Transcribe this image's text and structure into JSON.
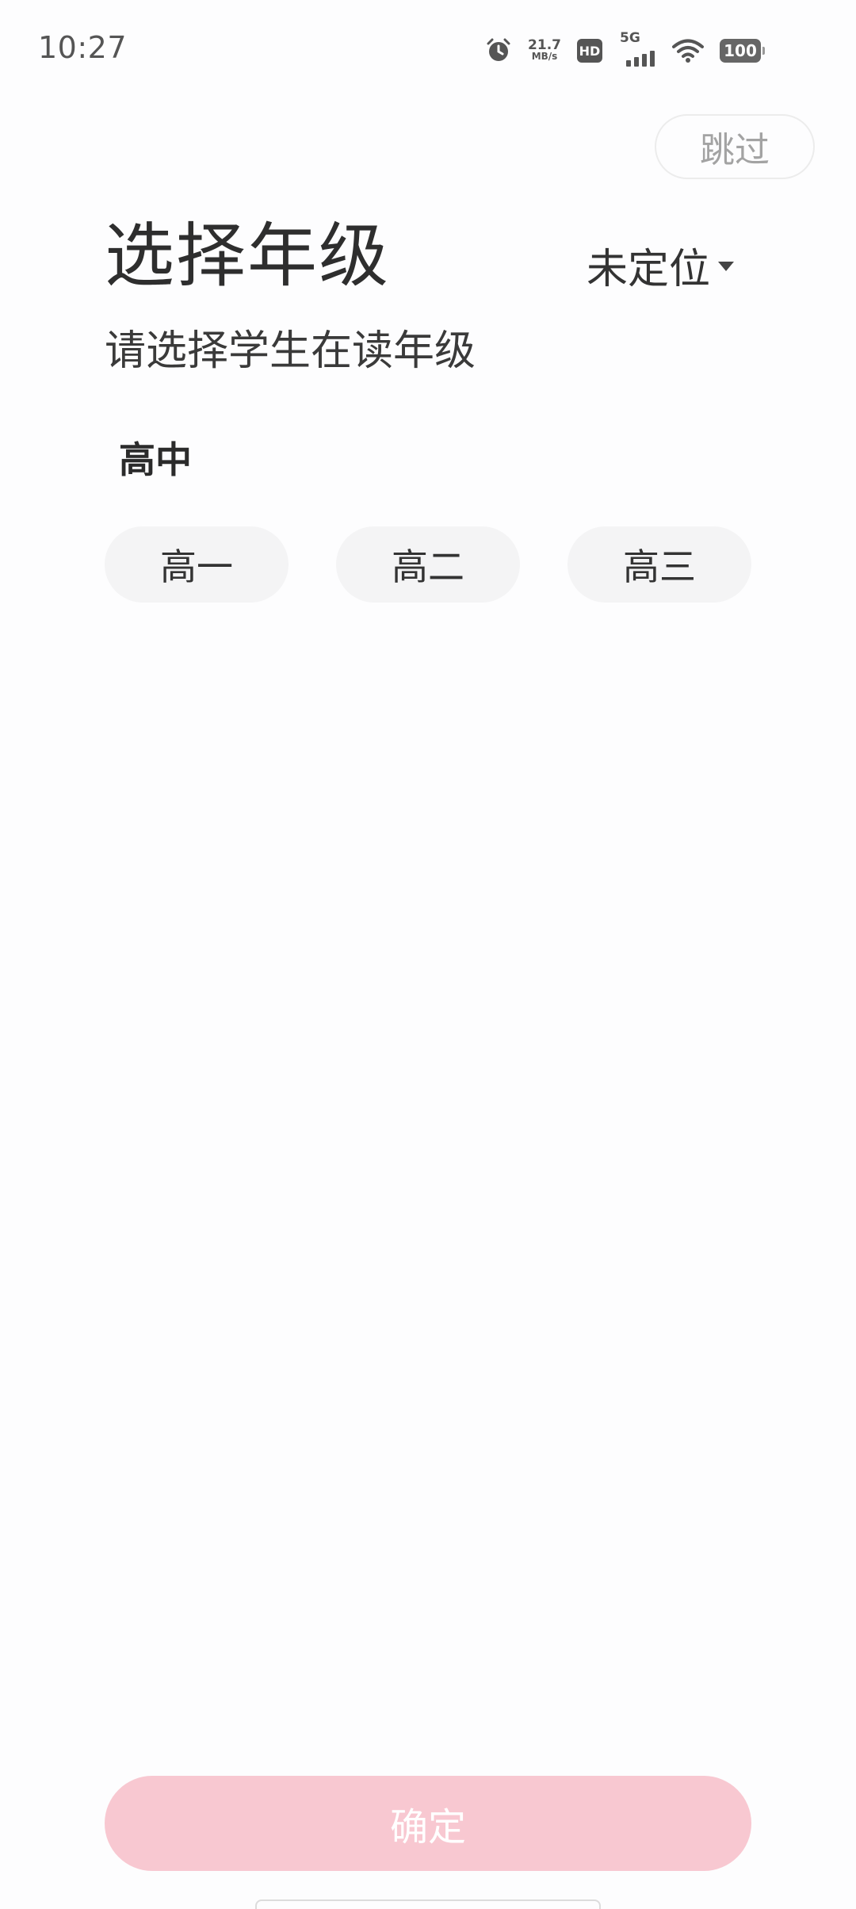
{
  "status_bar": {
    "time": "10:27",
    "net_speed_value": "21.7",
    "net_speed_unit": "MB/s",
    "hd_label": "HD",
    "network_type": "5G",
    "battery": "100",
    "icons": [
      "alarm-icon",
      "hd-icon",
      "signal-icon",
      "wifi-icon",
      "battery-icon"
    ]
  },
  "header": {
    "skip_label": "跳过",
    "title": "选择年级",
    "location_label": "未定位",
    "subtitle": "请选择学生在读年级"
  },
  "grades": {
    "section_title": "高中",
    "options": [
      {
        "label": "高一"
      },
      {
        "label": "高二"
      },
      {
        "label": "高三"
      }
    ]
  },
  "footer": {
    "confirm_label": "确定",
    "confirm_color": "#f8c8d1"
  }
}
